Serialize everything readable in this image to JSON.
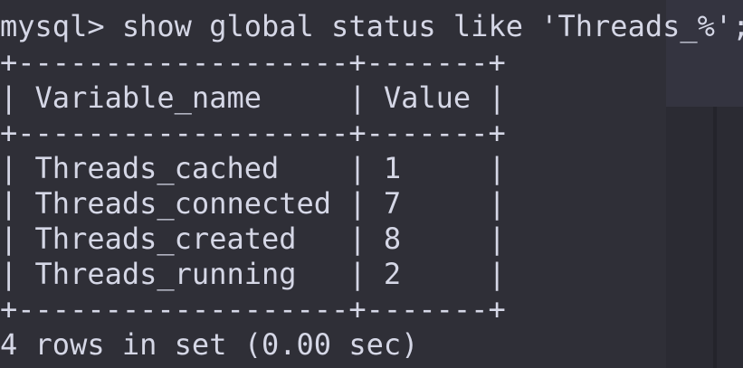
{
  "terminal": {
    "prompt": "mysql>",
    "command": "show global status like 'Threads_%';",
    "table": {
      "border_line": "+-------------------+-------+",
      "columns": [
        "Variable_name",
        "Value"
      ],
      "header_line": "| Variable_name     | Value |",
      "rows": [
        {
          "name": "Threads_cached",
          "value": "1",
          "line": "| Threads_cached    | 1     |"
        },
        {
          "name": "Threads_connected",
          "value": "7",
          "line": "| Threads_connected | 7     |"
        },
        {
          "name": "Threads_created",
          "value": "8",
          "line": "| Threads_created   | 8     |"
        },
        {
          "name": "Threads_running",
          "value": "2",
          "line": "| Threads_running   | 2     |"
        }
      ]
    },
    "footer": "4 rows in set (0.00 sec)"
  },
  "colors": {
    "background": "#2f2f37",
    "text": "#d5d7e6"
  }
}
